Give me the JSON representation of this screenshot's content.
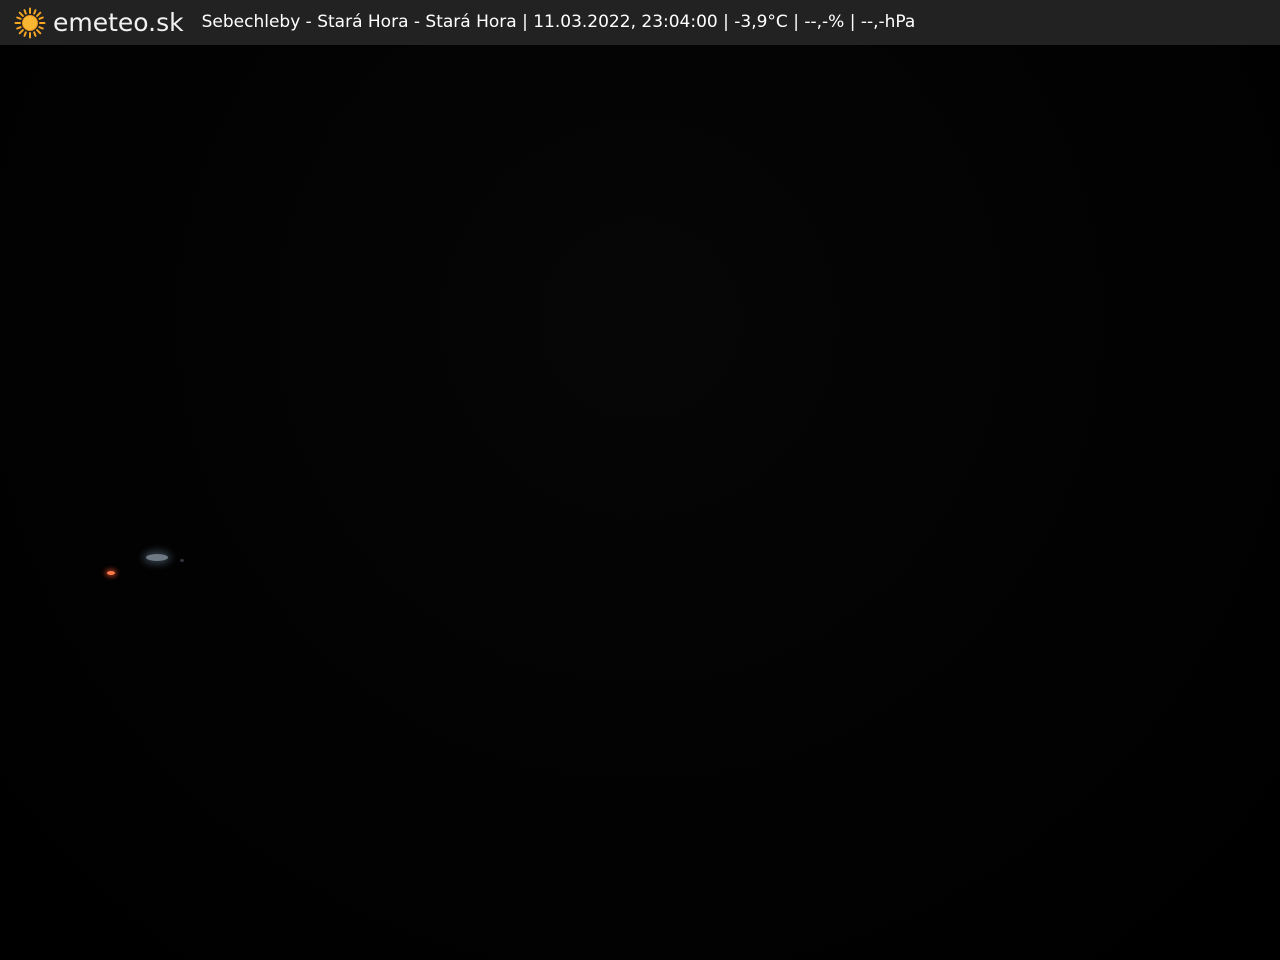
{
  "topbar": {
    "brand": "emeteo.sk",
    "logo_icon": "sun-icon",
    "caption": "Sebechleby - Stará Hora - Stará Hora | 11.03.2022, 23:04:00 | -3,9°C | --,-% | --,-hPa"
  },
  "colors": {
    "bar_background": "#222222",
    "sun": "#f5a623",
    "text": "#ffffff"
  }
}
